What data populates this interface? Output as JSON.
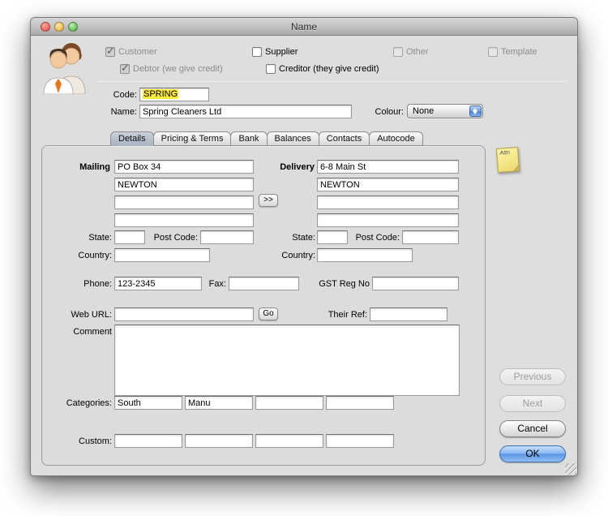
{
  "window": {
    "title": "Name"
  },
  "record_types": {
    "customer": {
      "label": "Customer",
      "checked": true,
      "disabled": true
    },
    "debtor": {
      "label": "Debtor (we give credit)",
      "checked": true,
      "disabled": true
    },
    "supplier": {
      "label": "Supplier",
      "checked": false,
      "disabled": false
    },
    "creditor": {
      "label": "Creditor (they give credit)",
      "checked": false,
      "disabled": false
    },
    "other": {
      "label": "Other",
      "checked": false,
      "disabled": true
    },
    "template": {
      "label": "Template",
      "checked": false,
      "disabled": true
    }
  },
  "identity": {
    "code_label": "Code:",
    "code_value": "SPRING",
    "name_label": "Name:",
    "name_value": "Spring Cleaners Ltd",
    "colour_label": "Colour:",
    "colour_value": "None"
  },
  "tabs": [
    {
      "label": "Details",
      "selected": true
    },
    {
      "label": "Pricing & Terms",
      "selected": false
    },
    {
      "label": "Bank",
      "selected": false
    },
    {
      "label": "Balances",
      "selected": false
    },
    {
      "label": "Contacts",
      "selected": false
    },
    {
      "label": "Autocode",
      "selected": false
    }
  ],
  "address": {
    "mailing_label": "Mailing",
    "delivery_label": "Delivery",
    "copy_button_label": ">>",
    "state_label": "State:",
    "post_code_label": "Post Code:",
    "country_label": "Country:",
    "mailing": {
      "line1": "PO Box 34",
      "line2": "NEWTON",
      "line3": "",
      "line4": "",
      "state": "",
      "post_code": "",
      "country": ""
    },
    "delivery": {
      "line1": "6-8 Main St",
      "line2": "NEWTON",
      "line3": "",
      "line4": "",
      "state": "",
      "post_code": "",
      "country": ""
    }
  },
  "contact": {
    "phone_label": "Phone:",
    "phone_value": "123-2345",
    "fax_label": "Fax:",
    "fax_value": "",
    "gst_label": "GST Reg No",
    "gst_value": "",
    "web_url_label": "Web URL:",
    "web_url_value": "",
    "go_button_label": "Go",
    "their_ref_label": "Their Ref:",
    "their_ref_value": "",
    "comment_label": "Comment",
    "comment_value": ""
  },
  "categories": {
    "label": "Categories:",
    "values": [
      "South",
      "Manu",
      "",
      ""
    ]
  },
  "custom": {
    "label": "Custom:",
    "values": [
      "",
      "",
      "",
      ""
    ]
  },
  "action_buttons": {
    "previous": {
      "label": "Previous",
      "disabled": true
    },
    "next": {
      "label": "Next",
      "disabled": true
    },
    "cancel": {
      "label": "Cancel",
      "disabled": false
    },
    "ok": {
      "label": "OK",
      "disabled": false,
      "default": true
    }
  },
  "note_icon": {
    "label": "Attn"
  },
  "colors": {
    "ok_button_blue": "#5a95e2",
    "code_highlight_yellow": "#f8e93a",
    "window_background": "#dedede",
    "selected_tab_gray_blue": "#a9b4c2",
    "sticky_note_yellow": "#f2e07a"
  }
}
